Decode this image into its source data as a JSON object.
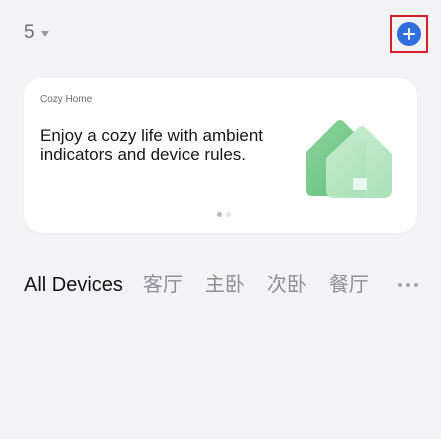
{
  "header": {
    "home_count": "5",
    "add_icon": "plus-circle-icon"
  },
  "banner": {
    "eyebrow": "Cozy Home",
    "text": "Enjoy a cozy life with ambient indicators and device rules.",
    "page": 1,
    "pages": 2
  },
  "tabs": [
    {
      "label": "All Devices",
      "active": true
    },
    {
      "label": "客厅"
    },
    {
      "label": "主卧"
    },
    {
      "label": "次卧"
    },
    {
      "label": "餐厅"
    }
  ],
  "more_icon": "more-dots-icon",
  "colors": {
    "accent": "#2f6fde",
    "highlight_border": "#d61f2a",
    "background": "#f3f3f6"
  }
}
